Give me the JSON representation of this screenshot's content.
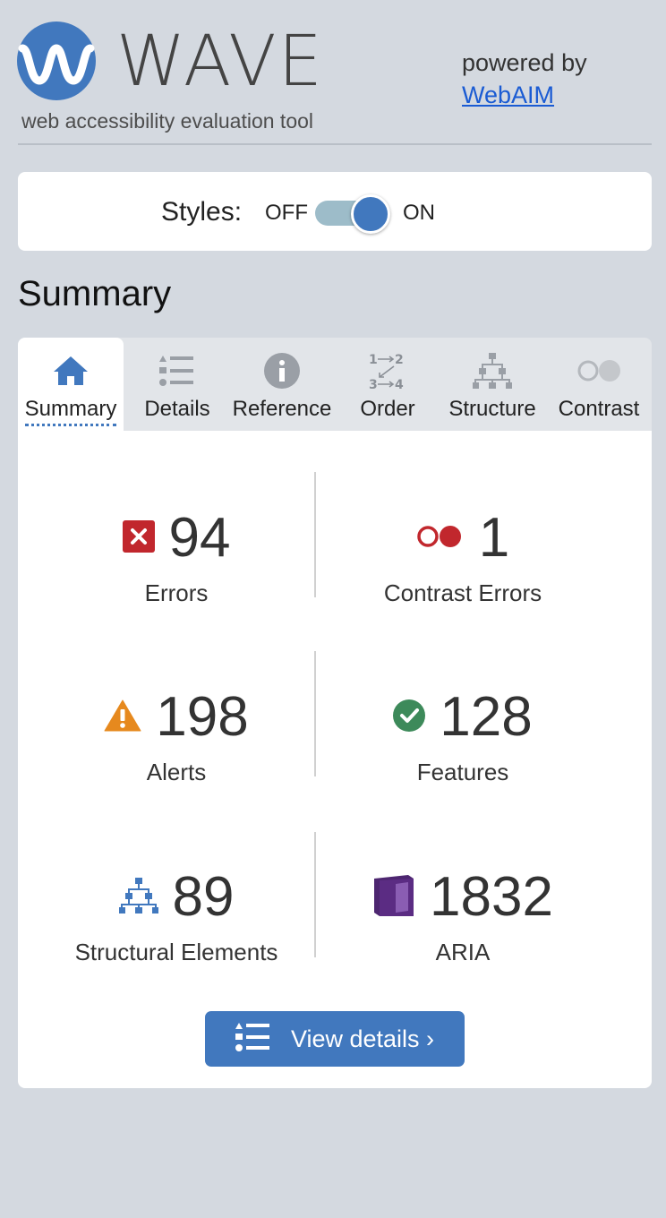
{
  "header": {
    "logo_text": "WAVE",
    "tagline": "web accessibility evaluation tool",
    "powered_by": "powered by",
    "webaim_link": "WebAIM"
  },
  "styles_toggle": {
    "label": "Styles:",
    "off": "OFF",
    "on": "ON",
    "state": "on"
  },
  "summary_heading": "Summary",
  "tabs": [
    {
      "label": "Summary",
      "icon": "home-icon",
      "active": true
    },
    {
      "label": "Details",
      "icon": "list-icon",
      "active": false
    },
    {
      "label": "Reference",
      "icon": "info-icon",
      "active": false
    },
    {
      "label": "Order",
      "icon": "order-icon",
      "active": false
    },
    {
      "label": "Structure",
      "icon": "structure-icon",
      "active": false
    },
    {
      "label": "Contrast",
      "icon": "contrast-icon",
      "active": false
    }
  ],
  "stats": {
    "errors": {
      "value": "94",
      "label": "Errors",
      "icon": "error-icon",
      "color": "#c1272d"
    },
    "contrast_errors": {
      "value": "1",
      "label": "Contrast Errors",
      "icon": "contrast-error-icon",
      "color": "#c1272d"
    },
    "alerts": {
      "value": "198",
      "label": "Alerts",
      "icon": "alert-icon",
      "color": "#e6891e"
    },
    "features": {
      "value": "128",
      "label": "Features",
      "icon": "feature-icon",
      "color": "#3d8a5a"
    },
    "structural": {
      "value": "89",
      "label": "Structural Elements",
      "icon": "structure-icon",
      "color": "#4178be"
    },
    "aria": {
      "value": "1832",
      "label": "ARIA",
      "icon": "aria-icon",
      "color": "#5b2c83"
    }
  },
  "view_details_button": "View details ›",
  "colors": {
    "accent": "#4178be",
    "background": "#d4d9e0"
  }
}
